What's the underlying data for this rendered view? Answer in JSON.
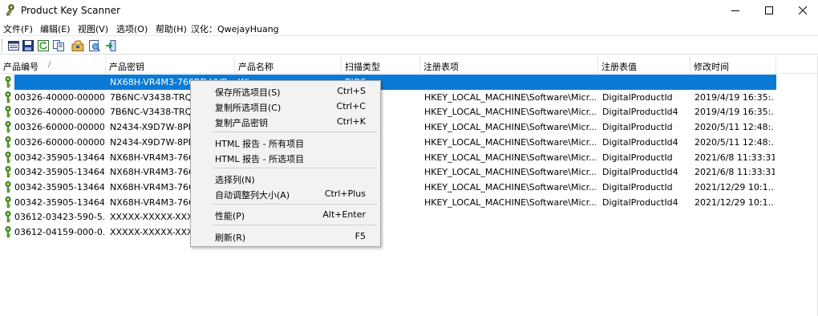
{
  "window": {
    "title": "Product Key Scanner"
  },
  "menu": [
    "文件(F)",
    "编辑(E)",
    "视图(V)",
    "选项(O)",
    "帮助(H)",
    "汉化：QwejayHuang"
  ],
  "toolbar": [
    "properties-icon",
    "save-icon",
    "refresh-icon",
    "copy-icon",
    "options-icon",
    "html-report-icon",
    "exit-icon"
  ],
  "columns": [
    "产品编号",
    "产品密钥",
    "产品名称",
    "扫描类型",
    "注册表项",
    "注册表值",
    "修改时间"
  ],
  "sort_indicator": "/",
  "rows": [
    {
      "id": "",
      "key": "NX68H-VR4M3-766RD-VVR",
      "name": "Wi",
      "scan": "BIOS",
      "regkey": "",
      "regval": "",
      "time": ""
    },
    {
      "id": "00326-40000-00000...",
      "key": "7B6NC-V3438-TRQ",
      "name": "",
      "scan": "",
      "regkey": "HKEY_LOCAL_MACHINE\\Software\\Micr...",
      "regval": "DigitalProductId",
      "time": "2019/4/19 16:35:..."
    },
    {
      "id": "00326-40000-00000...",
      "key": "7B6NC-V3438-TRQ",
      "name": "",
      "scan": "",
      "regkey": "HKEY_LOCAL_MACHINE\\Software\\Micr...",
      "regval": "DigitalProductId4",
      "time": "2019/4/19 16:35:..."
    },
    {
      "id": "00326-60000-00000...",
      "key": "N2434-X9D7W-8PF",
      "name": "",
      "scan": "",
      "regkey": "HKEY_LOCAL_MACHINE\\Software\\Micr...",
      "regval": "DigitalProductId",
      "time": "2020/5/11 12:48:..."
    },
    {
      "id": "00326-60000-00000...",
      "key": "N2434-X9D7W-8PF",
      "name": "",
      "scan": "",
      "regkey": "HKEY_LOCAL_MACHINE\\Software\\Micr...",
      "regval": "DigitalProductId4",
      "time": "2020/5/11 12:48:..."
    },
    {
      "id": "00342-35905-13464...",
      "key": "NX68H-VR4M3-766",
      "name": "",
      "scan": "",
      "regkey": "HKEY_LOCAL_MACHINE\\Software\\Micr...",
      "regval": "DigitalProductId",
      "time": "2021/6/8 11:33:31"
    },
    {
      "id": "00342-35905-13464...",
      "key": "NX68H-VR4M3-766",
      "name": "",
      "scan": "",
      "regkey": "HKEY_LOCAL_MACHINE\\Software\\Micr...",
      "regval": "DigitalProductId4",
      "time": "2021/6/8 11:33:31"
    },
    {
      "id": "00342-35905-13464...",
      "key": "NX68H-VR4M3-766",
      "name": "",
      "scan": "",
      "regkey": "HKEY_LOCAL_MACHINE\\Software\\Micr...",
      "regval": "DigitalProductId",
      "time": "2021/12/29 10:1..."
    },
    {
      "id": "00342-35905-13464...",
      "key": "NX68H-VR4M3-766",
      "name": "",
      "scan": "",
      "regkey": "HKEY_LOCAL_MACHINE\\Software\\Micr...",
      "regval": "DigitalProductId4",
      "time": "2021/12/29 10:1..."
    },
    {
      "id": "03612-03423-590-5...",
      "key": "XXXXX-XXXXX-XXX",
      "name": "",
      "scan": "",
      "regkey": "",
      "regval": "",
      "time": ""
    },
    {
      "id": "03612-04159-000-0...",
      "key": "XXXXX-XXXXX-XXX",
      "name": "",
      "scan": "",
      "regkey": "",
      "regval": "",
      "time": ""
    }
  ],
  "context_menu": [
    {
      "label": "保存所选项目(S)",
      "shortcut": "Ctrl+S"
    },
    {
      "label": "复制所选项目(C)",
      "shortcut": "Ctrl+C"
    },
    {
      "label": "复制产品密钥",
      "shortcut": "Ctrl+K"
    },
    {
      "label": "HTML 报告 - 所有项目",
      "shortcut": ""
    },
    {
      "label": "HTML 报告 - 所选项目",
      "shortcut": ""
    },
    {
      "label": "选择列(N)",
      "shortcut": ""
    },
    {
      "label": "自动调整列大小(A)",
      "shortcut": "Ctrl+Plus"
    },
    {
      "label": "性能(P)",
      "shortcut": "Alt+Enter"
    },
    {
      "label": "刷新(R)",
      "shortcut": "F5"
    }
  ],
  "colors": {
    "selection": "#0a7ad6",
    "key_icon": "#5aa52c",
    "menu_bg": "#f2f2f2"
  }
}
